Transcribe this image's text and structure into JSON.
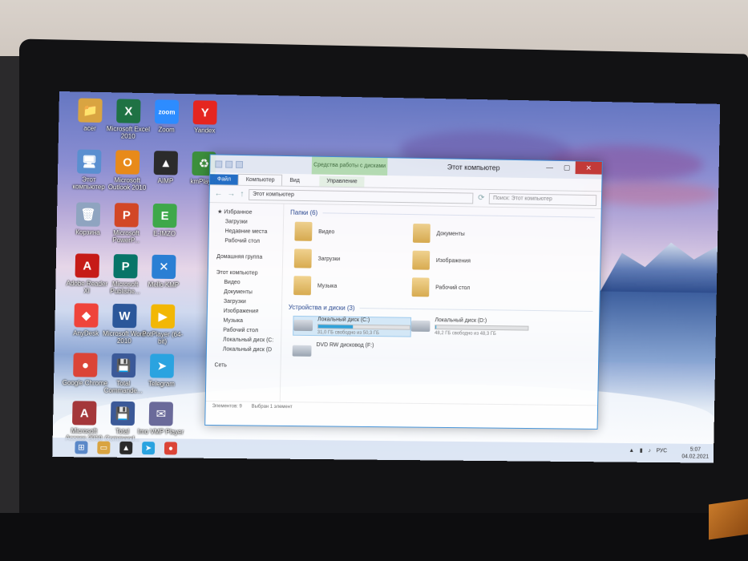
{
  "desktop_icons": [
    {
      "label": "acer",
      "color": "#d9a441",
      "glyph": "📁"
    },
    {
      "label": "Microsoft Excel 2010",
      "color": "#1f7244",
      "glyph": "X"
    },
    {
      "label": "Zoom",
      "color": "#2d8cff",
      "glyph": "zoom"
    },
    {
      "label": "Yandex",
      "color": "#e52620",
      "glyph": "Y"
    },
    {
      "label": "Этот компьютер",
      "color": "#5a8fd0",
      "glyph": "🖥"
    },
    {
      "label": "Microsoft Outlook 2010",
      "color": "#e88a1a",
      "glyph": "O"
    },
    {
      "label": "AIMP",
      "color": "#2b2b2b",
      "glyph": "▲"
    },
    {
      "label": "kmPlayer",
      "color": "#3c8f3c",
      "glyph": "♻"
    },
    {
      "label": "Корзина",
      "color": "#8fa4c0",
      "glyph": "🗑"
    },
    {
      "label": "Microsoft PowerP...",
      "color": "#d24726",
      "glyph": "P"
    },
    {
      "label": "E-IMZO",
      "color": "#3ea84a",
      "glyph": "E"
    },
    {
      "label": "Adobe Reader XI",
      "color": "#c61b17",
      "glyph": "A"
    },
    {
      "label": "Microsoft Publishe...",
      "color": "#077568",
      "glyph": "P"
    },
    {
      "label": "Mello KMP",
      "color": "#2a7fd4",
      "glyph": "✕"
    },
    {
      "label": "AnyDesk",
      "color": "#ef443b",
      "glyph": "◆"
    },
    {
      "label": "Microsoft Word 2010",
      "color": "#2b579a",
      "glyph": "W"
    },
    {
      "label": "PotPlayer (64-bit)",
      "color": "#f2b705",
      "glyph": "▶"
    },
    {
      "label": "Google Chrome",
      "color": "#db4437",
      "glyph": "●"
    },
    {
      "label": "Total Commande...",
      "color": "#3b5998",
      "glyph": "💾"
    },
    {
      "label": "Telegram",
      "color": "#2aa3e0",
      "glyph": "➤"
    },
    {
      "label": "Microsoft Access 2010",
      "color": "#a4373a",
      "glyph": "A"
    },
    {
      "label": "Total Command...",
      "color": "#3b5998",
      "glyph": "💾"
    },
    {
      "label": "Imo VMP Player",
      "color": "#6a6a9a",
      "glyph": "✉"
    }
  ],
  "explorer": {
    "context_tab": "Средства работы с дисками",
    "title": "Этот компьютер",
    "ribbon_tabs": [
      "Файл",
      "Компьютер",
      "Вид",
      "Управление"
    ],
    "address": "Этот компьютер",
    "search_placeholder": "Поиск: Этот компьютер",
    "nav": {
      "favorites": "Избранное",
      "favorites_items": [
        "Загрузки",
        "Недавние места",
        "Рабочий стол"
      ],
      "homegroup": "Домашняя группа",
      "this_pc": "Этот компьютер",
      "pc_items": [
        "Видео",
        "Документы",
        "Загрузки",
        "Изображения",
        "Музыка",
        "Рабочий стол",
        "Локальный диск (C:",
        "Локальный диск (D"
      ],
      "network": "Сеть"
    },
    "folders_header": "Папки (6)",
    "folders": [
      "Видео",
      "Документы",
      "Загрузки",
      "Изображения",
      "Музыка",
      "Рабочий стол"
    ],
    "devices_header": "Устройства и диски (3)",
    "drives": [
      {
        "name": "Локальный диск (C:)",
        "free": "31,0 ГБ свободно из 50,3 ГБ",
        "used_fraction": 0.38
      },
      {
        "name": "Локальный диск (D:)",
        "free": "48,2 ГБ свободно из 48,3 ГБ",
        "used_fraction": 0.01
      },
      {
        "name": "DVD RW дисковод (F:)",
        "free": "",
        "used_fraction": null
      }
    ],
    "status": {
      "items": "Элементов: 9",
      "selected": "Выбран 1 элемент"
    }
  },
  "taskbar": {
    "tray_lang": "РУС",
    "time": "5:07",
    "date": "04.02.2021"
  }
}
